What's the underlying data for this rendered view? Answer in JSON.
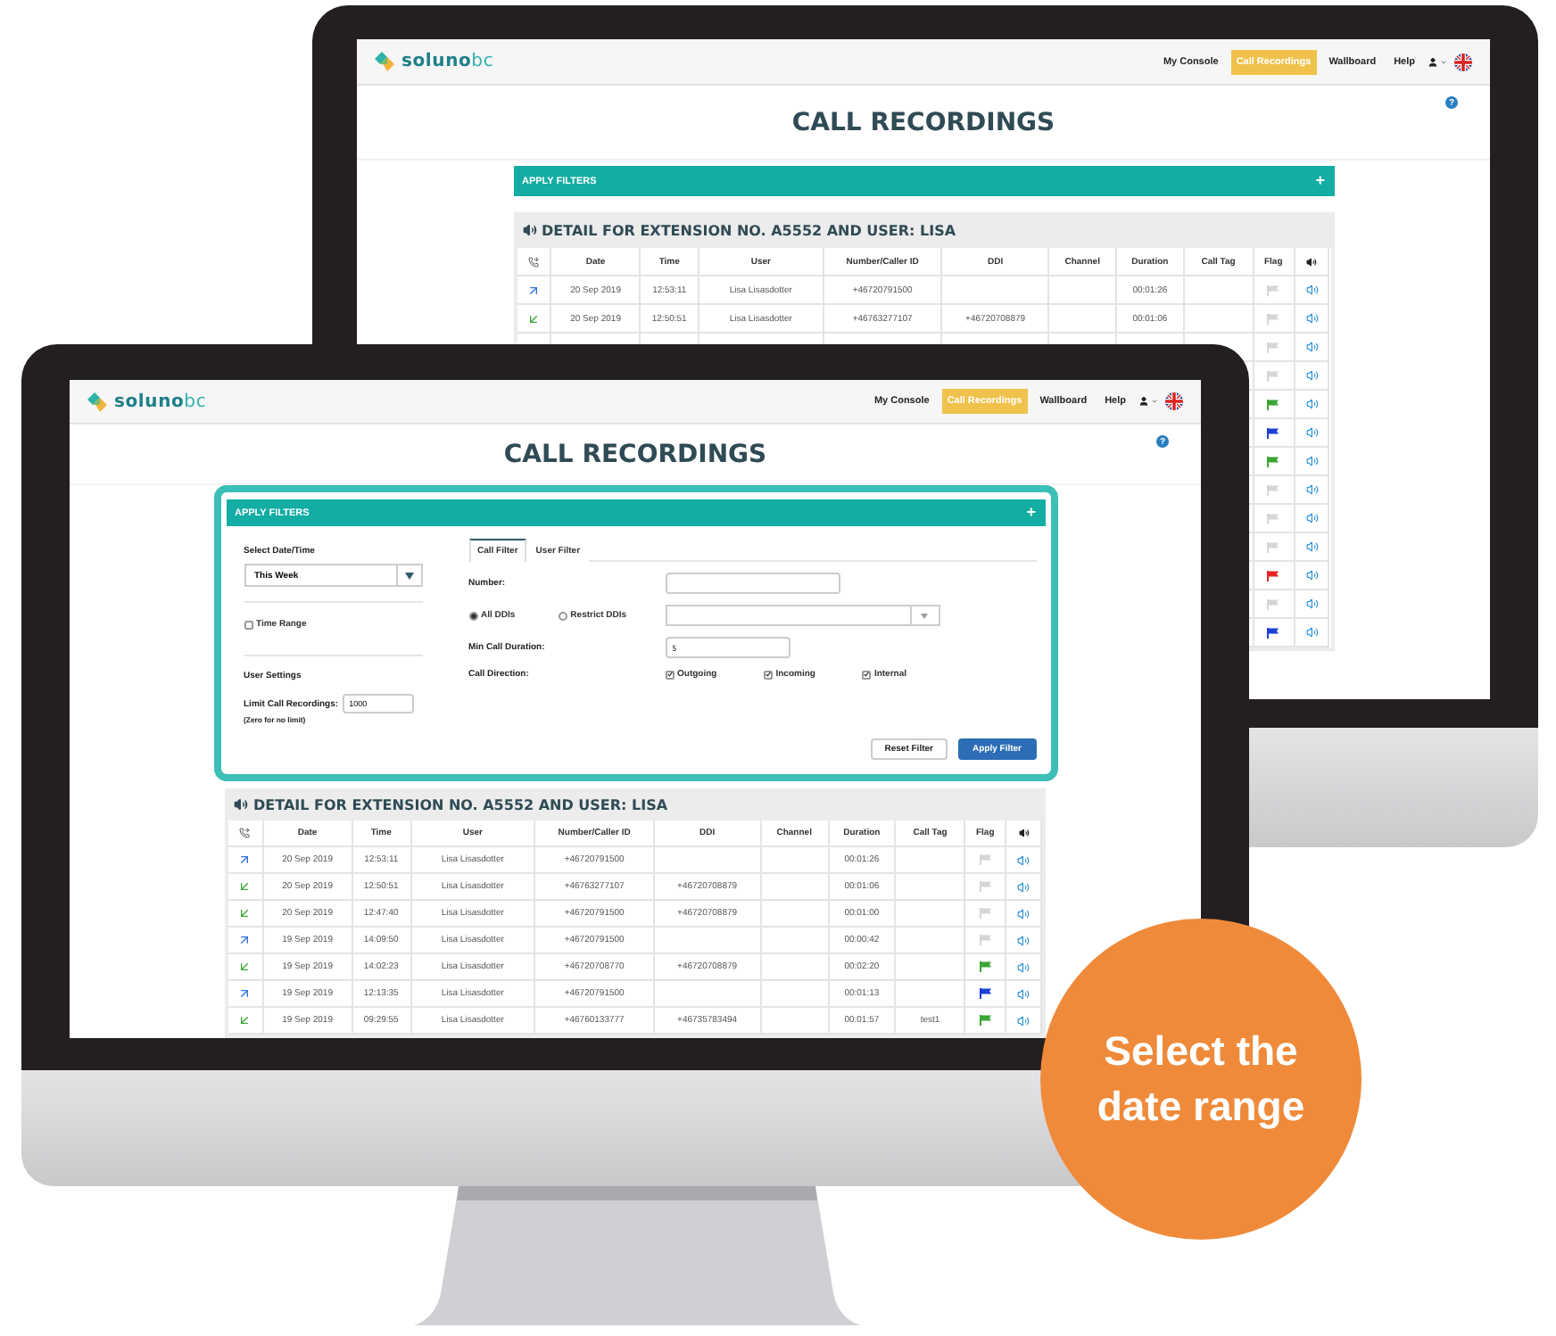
{
  "back_screen": {
    "logo": {
      "name": "soluno",
      "suffix": "bc"
    },
    "nav": [
      {
        "label": "My Console",
        "selected": false
      },
      {
        "label": "Call Recordings",
        "selected": true
      },
      {
        "label": "Wallboard",
        "selected": false
      },
      {
        "label": "Help",
        "selected": false
      }
    ],
    "title": "CALL RECORDINGS",
    "help": "?",
    "filters": {
      "title": "APPLY FILTERS",
      "toggle": "+"
    },
    "detail": {
      "title": "DETAIL FOR EXTENSION NO. A5552 AND USER: LISA",
      "columns": [
        "Date",
        "Time",
        "User",
        "Number/Caller ID",
        "DDI",
        "Channel",
        "Duration",
        "Call Tag",
        "Flag"
      ],
      "rows": [
        {
          "kind": "outgoing",
          "date": "20 Sep 2019",
          "time": "12:53:11",
          "user": "Lisa Lisasdotter",
          "number": "+46720791500",
          "duration": "00:01:26",
          "flag": {
            "color": "#d6d6d6"
          }
        },
        {
          "kind": "incoming",
          "date": "20 Sep 2019",
          "time": "12:50:51",
          "user": "Lisa Lisasdotter",
          "number": "+46763277107",
          "ddi": "+46720708879",
          "duration": "00:01:06",
          "flag": {
            "color": "#d6d6d6"
          }
        },
        {
          "flag": {
            "color": "#d6d6d6"
          }
        },
        {
          "flag": {
            "color": "#d6d6d6"
          }
        },
        {
          "flag": {
            "color": "#3aa635"
          }
        },
        {
          "flag": {
            "color": "#1b3fd6"
          }
        },
        {
          "flag": {
            "color": "#3aa635"
          }
        },
        {
          "flag": {
            "color": "#d6d6d6"
          }
        },
        {
          "flag": {
            "color": "#d6d6d6"
          }
        },
        {
          "flag": {
            "color": "#d6d6d6"
          }
        },
        {
          "flag": {
            "color": "#e8231f"
          }
        },
        {
          "flag": {
            "color": "#d6d6d6"
          }
        },
        {
          "flag": {
            "color": "#1b3fd6"
          }
        }
      ]
    }
  },
  "front_screen": {
    "logo": {
      "name": "soluno",
      "suffix": "bc"
    },
    "nav": [
      {
        "label": "My Console",
        "selected": false
      },
      {
        "label": "Call Recordings",
        "selected": true
      },
      {
        "label": "Wallboard",
        "selected": false
      },
      {
        "label": "Help",
        "selected": false
      }
    ],
    "title": "CALL RECORDINGS",
    "help": "?",
    "filters": {
      "title": "APPLY FILTERS",
      "toggle": "+",
      "date_label": "Select Date/Time",
      "date_value": "This Week",
      "time_range": {
        "label": "Time Range",
        "checked": false
      },
      "user_settings": "User Settings",
      "limit_label": "Limit Call Recordings:",
      "limit_value": "1000",
      "limit_hint": "(Zero for no limit)",
      "tabs": [
        {
          "label": "Call Filter",
          "selected": true
        },
        {
          "label": "User Filter",
          "selected": false
        }
      ],
      "number_label": "Number:",
      "ddi_options": [
        {
          "label": "All DDIs",
          "selected": true
        },
        {
          "label": "Restrict DDIs",
          "selected": false
        }
      ],
      "min_duration_label": "Min Call Duration:",
      "min_duration_value": "5",
      "direction_label": "Call Direction:",
      "directions": [
        {
          "label": "Outgoing",
          "checked": true
        },
        {
          "label": "Incoming",
          "checked": true
        },
        {
          "label": "Internal",
          "checked": true
        }
      ],
      "buttons": [
        {
          "label": "Reset Filter",
          "primary": false
        },
        {
          "label": "Apply Filter",
          "primary": true
        }
      ]
    },
    "detail": {
      "title": "DETAIL FOR EXTENSION NO. A5552 AND USER: LISA",
      "columns": [
        "Date",
        "Time",
        "User",
        "Number/Caller ID",
        "DDI",
        "Channel",
        "Duration",
        "Call Tag",
        "Flag"
      ],
      "rows": [
        {
          "kind": "outgoing",
          "date": "20 Sep 2019",
          "time": "12:53:11",
          "user": "Lisa Lisasdotter",
          "number": "+46720791500",
          "duration": "00:01:26",
          "flag": {
            "color": "#d6d6d6"
          }
        },
        {
          "kind": "incoming",
          "date": "20 Sep 2019",
          "time": "12:50:51",
          "user": "Lisa Lisasdotter",
          "number": "+46763277107",
          "ddi": "+46720708879",
          "duration": "00:01:06",
          "flag": {
            "color": "#d6d6d6"
          }
        },
        {
          "kind": "incoming",
          "date": "20 Sep 2019",
          "time": "12:47:40",
          "user": "Lisa Lisasdotter",
          "number": "+46720791500",
          "ddi": "+46720708879",
          "duration": "00:01:00",
          "flag": {
            "color": "#d6d6d6"
          }
        },
        {
          "kind": "outgoing",
          "date": "19 Sep 2019",
          "time": "14:09:50",
          "user": "Lisa Lisasdotter",
          "number": "+46720791500",
          "duration": "00:00:42",
          "flag": {
            "color": "#d6d6d6"
          }
        },
        {
          "kind": "incoming",
          "date": "19 Sep 2019",
          "time": "14:02:23",
          "user": "Lisa Lisasdotter",
          "number": "+46720708770",
          "ddi": "+46720708879",
          "duration": "00:02:20",
          "flag": {
            "color": "#3aa635"
          }
        },
        {
          "kind": "outgoing",
          "date": "19 Sep 2019",
          "time": "12:13:35",
          "user": "Lisa Lisasdotter",
          "number": "+46720791500",
          "duration": "00:01:13",
          "flag": {
            "color": "#1b3fd6"
          }
        },
        {
          "kind": "incoming",
          "date": "19 Sep 2019",
          "time": "09:29:55",
          "user": "Lisa Lisasdotter",
          "number": "+46760133777",
          "ddi": "+46735783494",
          "duration": "00:01:57",
          "call_tag": "test1",
          "flag": {
            "color": "#3aa635"
          }
        }
      ]
    }
  },
  "callout": "Select the date range"
}
